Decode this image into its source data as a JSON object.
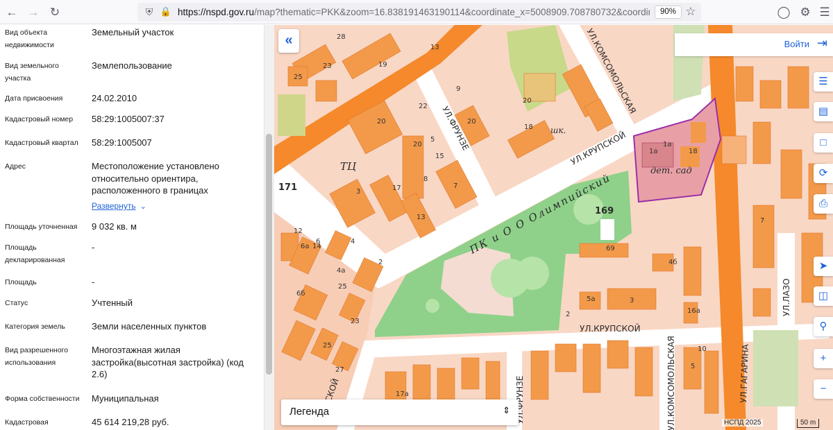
{
  "browser": {
    "url_host": "https://nspd.gov.ru",
    "url_rest": "/map?thematic=PKK&zoom=16.838191463190114&coordinate_x=5008909.708780732&coordinate_y=",
    "zoom_badge": "90%",
    "icons": [
      "back-arrow-icon",
      "forward-arrow-icon",
      "reload-icon",
      "shield-icon",
      "lock-icon",
      "star-icon",
      "pocket-icon",
      "extensions-icon",
      "menu-icon"
    ]
  },
  "info_panel": {
    "rows": [
      {
        "label": "Вид объекта недвижимости",
        "value": "Земельный участок"
      },
      {
        "label": "Вид земельного участка",
        "value": "Землепользование"
      },
      {
        "label": "Дата присвоения",
        "value": "24.02.2010"
      },
      {
        "label": "Кадастровый номер",
        "value": "58:29:1005007:37"
      },
      {
        "label": "Кадастровый квартал",
        "value": "58:29:1005007"
      },
      {
        "label": "Адрес",
        "value": "Местоположение установлено относительно ориентира, расположенного в границах"
      },
      {
        "label": "Площадь уточненная",
        "value": "9 032 кв. м"
      },
      {
        "label": "Площадь декларированная",
        "value": "-"
      },
      {
        "label": "Площадь",
        "value": "-"
      },
      {
        "label": "Статус",
        "value": "Учтенный"
      },
      {
        "label": "Категория земель",
        "value": "Земли населенных пунктов"
      },
      {
        "label": "Вид разрешенного использования",
        "value": "Многоэтажная жилая застройка(высотная застройка) (код 2.6)"
      },
      {
        "label": "Форма собственности",
        "value": "Муниципальная"
      },
      {
        "label": "Кадастровая",
        "value": "45 614 219,28 руб."
      }
    ],
    "expand_label": "Развернуть"
  },
  "map": {
    "login_label": "Войти",
    "legend_label": "Легенда",
    "attribution": "НСПД 2025",
    "scale_label": "50 m",
    "labels": {
      "kupskoy_top": "УЛ.КРУПСКОЙ",
      "kupskoy_mid": "УЛ.КРУПСКОЙ",
      "kupskoy_left": "КРУПСКОЙ",
      "frunze_top": "УЛ.ФРУНЗЕ",
      "frunze_bottom": "УЛ.ФРУНЗЕ",
      "komsomol_top": "УЛ.КОМСОМОЛЬСКАЯ",
      "komsomol_bottom": "УЛ.КОМСОМОЛЬСКАЯ",
      "gagarina": "УЛ.ГАГАРИНА",
      "lazo": "УЛ.ЛАЗО",
      "ul_right": "УЛ",
      "park": "ПК и О О Олимпийский",
      "det_sad": "дет. сад",
      "shk": "шк.",
      "tc": "ТЦ",
      "n169": "169",
      "n171": "171"
    },
    "house_numbers": [
      "28",
      "19",
      "13",
      "23",
      "25",
      "20",
      "22",
      "20",
      "15",
      "7",
      "20",
      "18",
      "20",
      "5",
      "9",
      "1а",
      "18",
      "1а",
      "12",
      "14",
      "3",
      "17",
      "13",
      "8",
      "6",
      "6а",
      "4",
      "4а",
      "2",
      "6б",
      "25",
      "23",
      "25",
      "27",
      "69",
      "4б",
      "3",
      "5а",
      "16а",
      "10",
      "7",
      "17а",
      "2",
      "5"
    ],
    "colors": {
      "background": "#f9d7c5",
      "road": "#ffffff",
      "main_road": "#f5892b",
      "building": "#f39a4a",
      "park": "#8fd18a",
      "selected_fill": "#e8a0a6",
      "selected_border": "#9b2fa8",
      "accent": "#1e63d8"
    },
    "side_buttons": [
      "layers-icon",
      "ruler-icon",
      "select-area-icon",
      "share-icon",
      "print-icon",
      "locate-icon",
      "split-screen-icon",
      "search-location-icon",
      "zoom-in-icon",
      "zoom-out-icon"
    ]
  }
}
